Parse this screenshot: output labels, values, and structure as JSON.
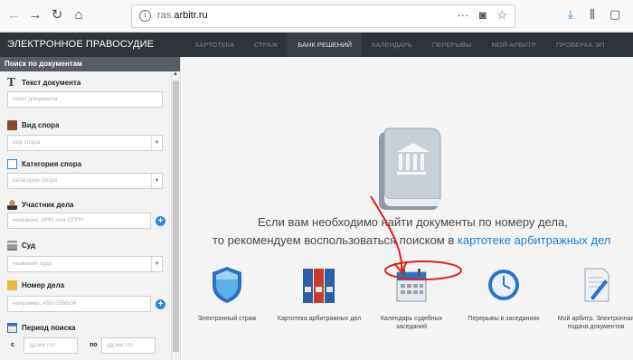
{
  "browser": {
    "url_host": "ras.",
    "url_domain": "arbitr.ru",
    "icons": [
      "back-icon",
      "forward-icon",
      "reload-icon",
      "home-icon",
      "info-icon",
      "more-icon",
      "pocket-icon",
      "star-icon",
      "download-icon",
      "library-icon",
      "sidebar-icon"
    ]
  },
  "header": {
    "logo": "ЭЛЕКТРОННОЕ ПРАВОСУДИЕ",
    "nav": [
      {
        "label": "КАРТОТЕКА"
      },
      {
        "label": "СТРАЖ"
      },
      {
        "label": "БАНК РЕШЕНИЙ"
      },
      {
        "label": "КАЛЕНДАРЬ"
      },
      {
        "label": "ПЕРЕРЫВЫ"
      },
      {
        "label": "МОЙ АРБИТР"
      },
      {
        "label": "ПРОВЕРКА ЭП"
      }
    ]
  },
  "sidebar": {
    "title": "Поиск по документам",
    "fields": {
      "text_label": "Текст документа",
      "text_placeholder": "текст документа",
      "dispute_type_label": "Вид спора",
      "dispute_type_placeholder": "вид спора",
      "dispute_category_label": "Категория спора",
      "dispute_category_placeholder": "категория спора",
      "participant_label": "Участник дела",
      "participant_placeholder": "название, ИНН или ОГРН",
      "court_label": "Суд",
      "court_placeholder": "название суда",
      "case_number_label": "Номер дела",
      "case_number_placeholder": "например, А50-5568/08",
      "period_label": "Период поиска",
      "period_from_label": "с",
      "period_from_placeholder": "дд.мм.гггг",
      "period_to_label": "по",
      "period_to_placeholder": "дд.мм.гггг"
    }
  },
  "main": {
    "hint_line1": "Если вам необходимо найти документы по номеру дела,",
    "hint_line2_prefix": "то рекомендуем воспользоваться поиском в ",
    "hint_link": "картотеке арбитражных дел",
    "services": [
      {
        "label": "Электронный страж",
        "icon": "shield-icon"
      },
      {
        "label": "Картотека арбитражных дел",
        "icon": "binders-icon"
      },
      {
        "label": "Календарь судебных заседаний",
        "icon": "calendar-icon"
      },
      {
        "label": "Перерывы в заседаниях",
        "icon": "clock-icon"
      },
      {
        "label": "Мой арбитр. Электронная подача документов",
        "icon": "document-icon"
      }
    ]
  },
  "colors": {
    "header_bg": "#2f333a",
    "link": "#1a7fd1",
    "annotation_red": "#e0201b"
  }
}
